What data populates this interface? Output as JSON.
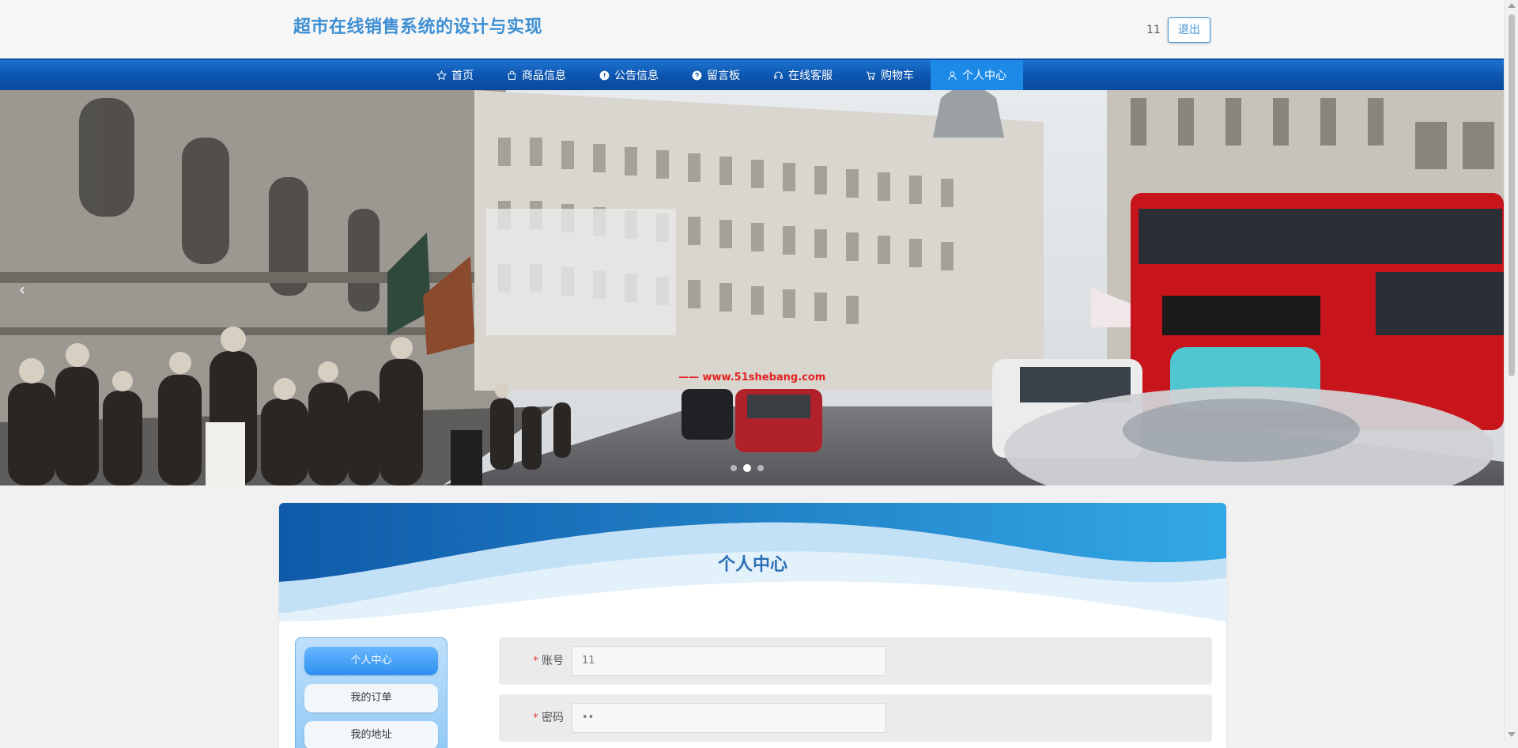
{
  "header": {
    "site_title": "超市在线销售系统的设计与实现",
    "user_name": "11",
    "logout_label": "退出"
  },
  "nav": {
    "items": [
      {
        "label": "首页",
        "icon": "star-icon"
      },
      {
        "label": "商品信息",
        "icon": "bag-icon"
      },
      {
        "label": "公告信息",
        "icon": "alert-circle-icon"
      },
      {
        "label": "留言板",
        "icon": "question-circle-icon"
      },
      {
        "label": "在线客服",
        "icon": "headset-icon"
      },
      {
        "label": "购物车",
        "icon": "cart-icon"
      },
      {
        "label": "个人中心",
        "icon": "user-icon"
      }
    ],
    "active_index": 6
  },
  "banner": {
    "prev_arrow": "‹",
    "dot_count": 3,
    "active_dot": 1,
    "watermark": "—— www.51shebang.com"
  },
  "panel": {
    "title": "个人中心",
    "side_menu": [
      "个人中心",
      "我的订单",
      "我的地址"
    ],
    "form": {
      "required_mark": "*",
      "fields": [
        {
          "label": "账号",
          "value": "11"
        },
        {
          "label": "密码",
          "value": "••"
        }
      ]
    }
  },
  "colors": {
    "nav_blue": "#0c56b0",
    "nav_active": "#1e8ae8",
    "title_blue": "#3e8fd3",
    "panel_title": "#2c6fb5"
  }
}
